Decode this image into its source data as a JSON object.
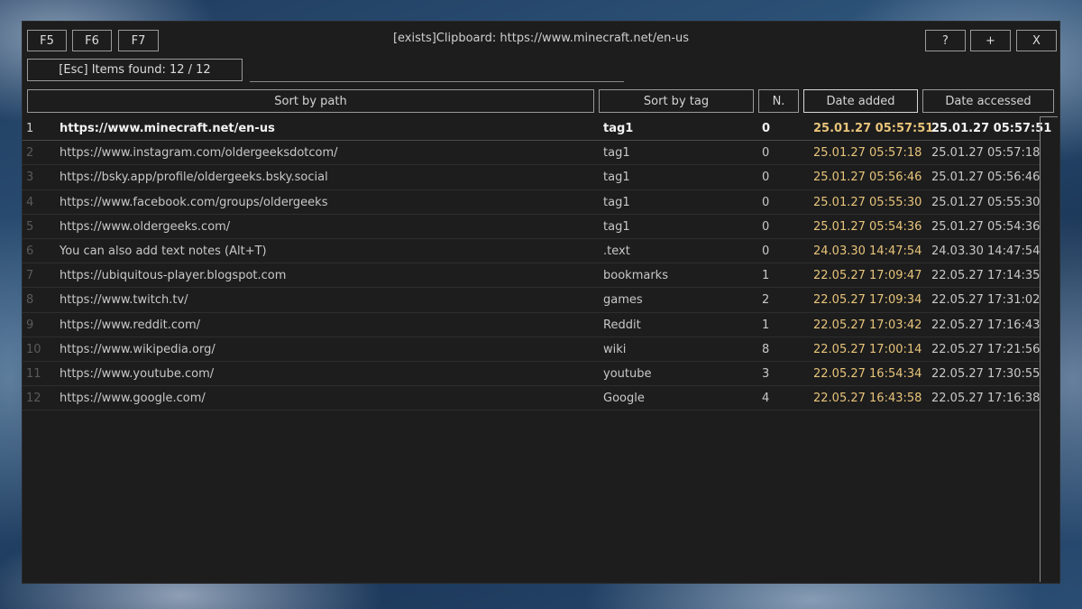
{
  "toolbar": {
    "f5": "F5",
    "f6": "F6",
    "f7": "F7",
    "help": "?",
    "add": "+",
    "close": "X"
  },
  "title": "[exists]Clipboard: https://www.minecraft.net/en-us",
  "search": {
    "label": "[Esc] Items found:  12  /  12",
    "value": ""
  },
  "headers": {
    "path": "Sort by path",
    "tag": "Sort by tag",
    "n": "N.",
    "added": "Date added",
    "accessed": "Date accessed"
  },
  "colors": {
    "date_added": "#e8c47a",
    "background": "#1d1d1d"
  },
  "rows": [
    {
      "num": "1",
      "path": "https://www.minecraft.net/en-us",
      "tag": "tag1",
      "n": "0",
      "added": "25.01.27 05:57:51",
      "accessed": "25.01.27 05:57:51"
    },
    {
      "num": "2",
      "path": "https://www.instagram.com/oldergeeksdotcom/",
      "tag": "tag1",
      "n": "0",
      "added": "25.01.27 05:57:18",
      "accessed": "25.01.27 05:57:18"
    },
    {
      "num": "3",
      "path": "https://bsky.app/profile/oldergeeks.bsky.social",
      "tag": "tag1",
      "n": "0",
      "added": "25.01.27 05:56:46",
      "accessed": "25.01.27 05:56:46"
    },
    {
      "num": "4",
      "path": "https://www.facebook.com/groups/oldergeeks",
      "tag": "tag1",
      "n": "0",
      "added": "25.01.27 05:55:30",
      "accessed": "25.01.27 05:55:30"
    },
    {
      "num": "5",
      "path": "https://www.oldergeeks.com/",
      "tag": "tag1",
      "n": "0",
      "added": "25.01.27 05:54:36",
      "accessed": "25.01.27 05:54:36"
    },
    {
      "num": "6",
      "path": "You can also add text notes (Alt+T)",
      "tag": ".text",
      "n": "0",
      "added": "24.03.30 14:47:54",
      "accessed": "24.03.30 14:47:54"
    },
    {
      "num": "7",
      "path": "https://ubiquitous-player.blogspot.com",
      "tag": "bookmarks",
      "n": "1",
      "added": "22.05.27 17:09:47",
      "accessed": "22.05.27 17:14:35"
    },
    {
      "num": "8",
      "path": "https://www.twitch.tv/",
      "tag": "games",
      "n": "2",
      "added": "22.05.27 17:09:34",
      "accessed": "22.05.27 17:31:02"
    },
    {
      "num": "9",
      "path": "https://www.reddit.com/",
      "tag": "Reddit",
      "n": "1",
      "added": "22.05.27 17:03:42",
      "accessed": "22.05.27 17:16:43"
    },
    {
      "num": "10",
      "path": "https://www.wikipedia.org/",
      "tag": "wiki",
      "n": "8",
      "added": "22.05.27 17:00:14",
      "accessed": "22.05.27 17:21:56"
    },
    {
      "num": "11",
      "path": "https://www.youtube.com/",
      "tag": "youtube",
      "n": "3",
      "added": "22.05.27 16:54:34",
      "accessed": "22.05.27 17:30:55"
    },
    {
      "num": "12",
      "path": "https://www.google.com/",
      "tag": "Google",
      "n": "4",
      "added": "22.05.27 16:43:58",
      "accessed": "22.05.27 17:16:38"
    }
  ]
}
